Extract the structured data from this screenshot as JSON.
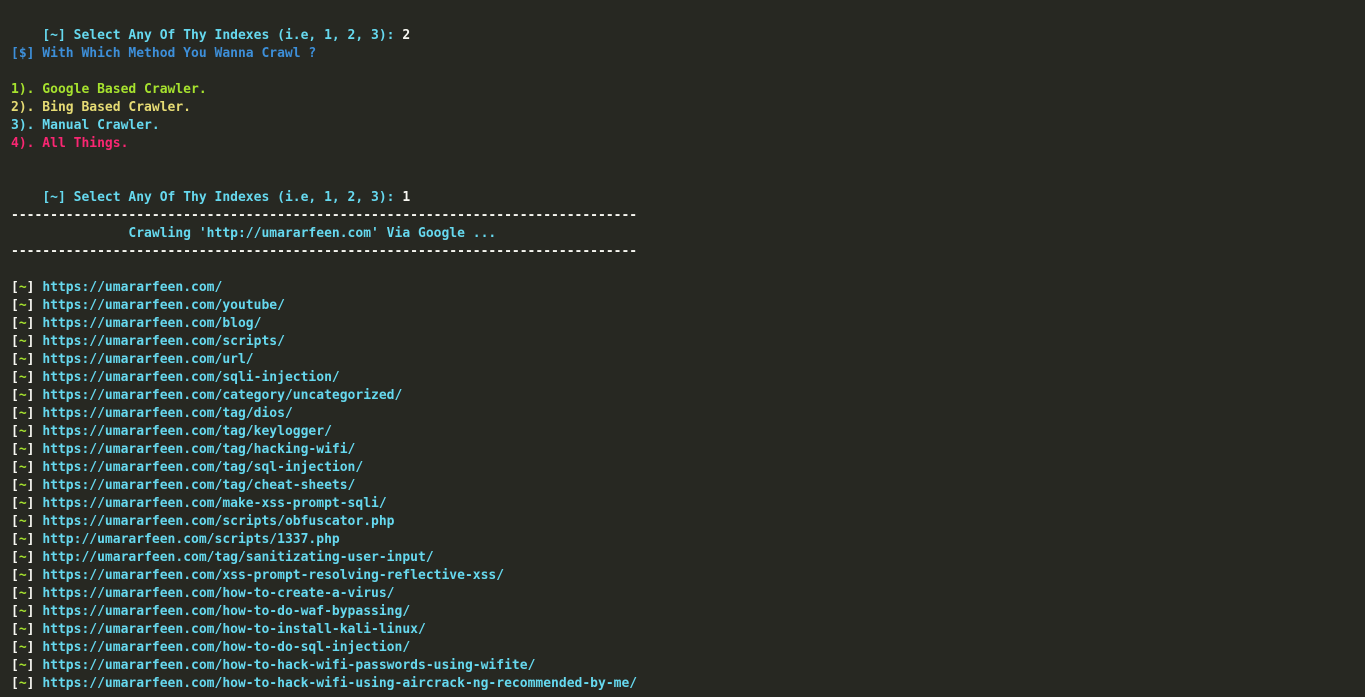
{
  "prompt1": {
    "text": "[~] Select Any Of Thy Indexes (i.e, 1, 2, 3): ",
    "answer": "2"
  },
  "method_question": "[$] With Which Method You Wanna Crawl ?",
  "menu": [
    {
      "text": "1). Google Based Crawler.",
      "color": "#a6e22e"
    },
    {
      "text": "2). Bing Based Crawler.",
      "color": "#e6db74"
    },
    {
      "text": "3). Manual Crawler.",
      "color": "#66d9ef"
    },
    {
      "text": "4). All Things.",
      "color": "#f92672"
    }
  ],
  "prompt2": {
    "text": "[~] Select Any Of Thy Indexes (i.e, 1, 2, 3): ",
    "answer": "1"
  },
  "separator": "--------------------------------------------------------------------------------",
  "crawl_banner": "               Crawling 'http://umararfeen.com' Via Google ...",
  "result_open": "[",
  "result_mark": "~",
  "result_close": "]",
  "results": [
    "https://umararfeen.com/",
    "https://umararfeen.com/youtube/",
    "https://umararfeen.com/blog/",
    "https://umararfeen.com/scripts/",
    "https://umararfeen.com/url/",
    "https://umararfeen.com/sqli-injection/",
    "https://umararfeen.com/category/uncategorized/",
    "https://umararfeen.com/tag/dios/",
    "https://umararfeen.com/tag/keylogger/",
    "https://umararfeen.com/tag/hacking-wifi/",
    "https://umararfeen.com/tag/sql-injection/",
    "https://umararfeen.com/tag/cheat-sheets/",
    "https://umararfeen.com/make-xss-prompt-sqli/",
    "https://umararfeen.com/scripts/obfuscator.php",
    "http://umararfeen.com/scripts/1337.php",
    "http://umararfeen.com/tag/sanitizating-user-input/",
    "https://umararfeen.com/xss-prompt-resolving-reflective-xss/",
    "https://umararfeen.com/how-to-create-a-virus/",
    "https://umararfeen.com/how-to-do-waf-bypassing/",
    "https://umararfeen.com/how-to-install-kali-linux/",
    "https://umararfeen.com/how-to-do-sql-injection/",
    "https://umararfeen.com/how-to-hack-wifi-passwords-using-wifite/",
    "https://umararfeen.com/how-to-hack-wifi-using-aircrack-ng-recommended-by-me/"
  ],
  "colors": {
    "background": "#272822",
    "cyan": "#66d9ef",
    "blue": "#3d8fd9",
    "green": "#a6e22e",
    "yellow": "#e6db74",
    "red": "#f92672",
    "white": "#f8f8f2"
  }
}
